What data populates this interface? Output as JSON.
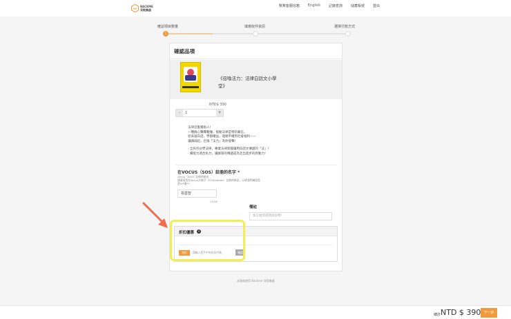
{
  "header": {
    "logo_text": "BACKME\n貝殼集器",
    "nav": [
      "幫幫客服信箱",
      "English",
      "記錄查詢",
      "儲蓄帳號",
      "登出"
    ]
  },
  "steps": {
    "labels": [
      "確認項目數量",
      "填寫收件資訊",
      "選擇付款方式"
    ],
    "active_index": 0,
    "active_number": "1"
  },
  "card": {
    "title": "確認品項",
    "product": {
      "name": "《召喚法力：法律白話文小學堂》",
      "price": "NTD$ 390",
      "quantity": "1",
      "minus": "-",
      "plus": "+"
    },
    "description": [
      "法律這隻獨角人！",
      "一種群心聲聲難懂，撥動法律是特的載信，",
      "從表論白話，學都權益，理順平權到社會福利——",
      "讓讀再起，召喚「法力」為你發聲！",
      "",
      "‧ 全民作伙學法律，專業法律新聞讓用白話文傳遞的「法」！",
      "‧ 備能力適合民力，讓群眾的傳遞成為走出進步的原動力！"
    ],
    "name_field": {
      "title": "在VOCUS（SOS）註冊的名字 *",
      "hint": [
        "Vocus（SOS）註冊的帳名",
        "請填寫您在Vocus方格子（SOS/reader）註冊的帳名，以便我們確認您",
        "是VIP會**"
      ],
      "value": "捐善智",
      "counter": "(3/48)"
    },
    "note": {
      "label": "備註",
      "placeholder": "留言給得得我說說嗎！"
    },
    "discount": {
      "title": "折扣優惠",
      "info_icon": "i",
      "badge": "折扣",
      "placeholder": "請輸入您手中的折扣代碼",
      "use_button": "確認"
    }
  },
  "footer": {
    "note": "本服務使用 Backme 貝殼集器"
  },
  "bottom": {
    "total_label": "總計",
    "total_value": "NTD $ 390",
    "next_button": "下一步"
  },
  "colors": {
    "accent": "#f19a3c",
    "highlight": "#f2ef4f",
    "arrow": "#f26b4e"
  }
}
